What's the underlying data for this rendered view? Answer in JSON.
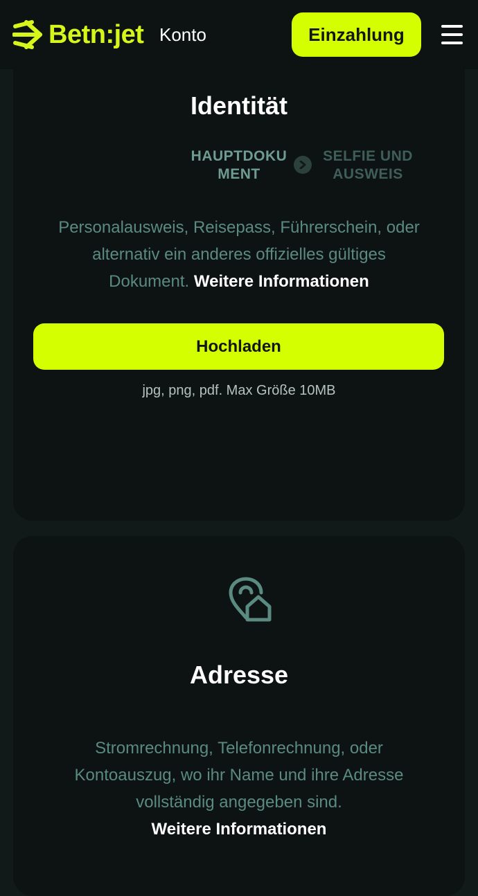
{
  "header": {
    "logo_text": "Betn:jet",
    "nav_label": "Konto",
    "deposit_label": "Einzahlung",
    "menu_icon": "hamburger-menu-icon"
  },
  "identity": {
    "title": "Identität",
    "steps": [
      {
        "label_line1": "HAUPTDOKU",
        "label_line2": "MENT",
        "state": "active"
      },
      {
        "label_line1": "SELFIE UND",
        "label_line2": "AUSWEIS",
        "state": "inactive"
      }
    ],
    "step_separator_icon": "chevron-right-circle-icon",
    "description_line1": "Personalausweis, Reisepass, Führerschein, oder",
    "description_line2": "alternativ ein anderes offizielles gültiges",
    "description_line3": "Dokument.",
    "more_info_label": "Weitere Informationen",
    "upload_label": "Hochladen",
    "file_hint": "jpg, png, pdf. Max Größe 10MB"
  },
  "address": {
    "icon": "location-pin-home-icon",
    "title": "Adresse",
    "description_line1": "Stromrechnung, Telefonrechnung, oder",
    "description_line2": "Kontoauszug, wo ihr Name und ihre Adresse",
    "description_line3": "vollständig angegeben sind.",
    "more_info_label": "Weitere Informationen"
  },
  "colors": {
    "accent": "#d4ff00",
    "background": "#121a19",
    "card": "#0c1312",
    "muted_text": "#5a8a80"
  }
}
